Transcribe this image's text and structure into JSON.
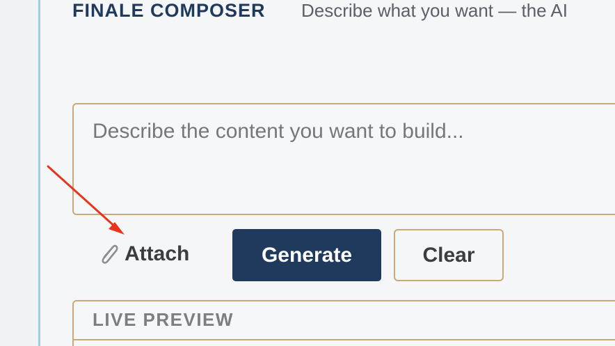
{
  "header": {
    "title": "FINALE COMPOSER",
    "subtitle": "Describe what you want — the AI"
  },
  "composer": {
    "prompt_placeholder": "Describe the content you want to build...",
    "prompt_value": "",
    "attach_icon": "paperclip-icon",
    "attach_label": "Attach",
    "generate_label": "Generate",
    "clear_label": "Clear"
  },
  "preview": {
    "title": "LIVE PREVIEW"
  },
  "annotation": {
    "arrow_color": "#e8341c",
    "arrow_icon": "red-arrow"
  },
  "colors": {
    "brand_navy": "#1f3a5c",
    "accent_tan": "#c9a978",
    "rail_blue": "#9fcfe0",
    "background": "#f5f6f8"
  }
}
